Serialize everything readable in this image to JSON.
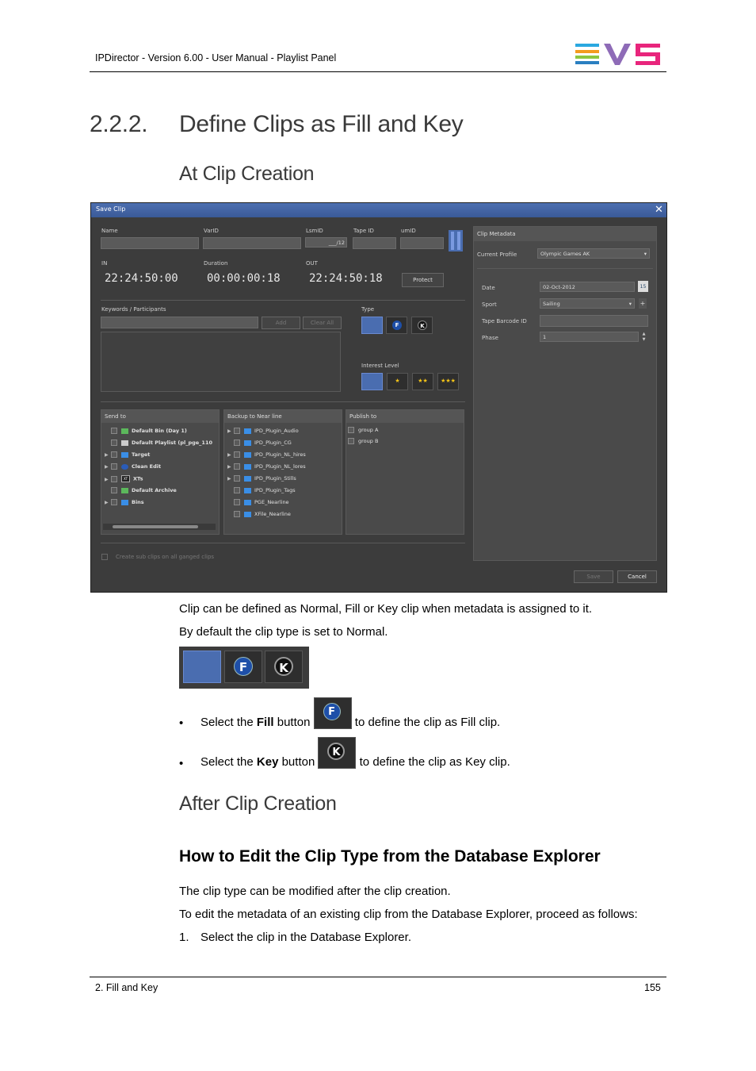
{
  "header": {
    "title": "IPDirector - Version 6.00 - User Manual - Playlist Panel",
    "logo_text": "EVS"
  },
  "section": {
    "number": "2.2.2.",
    "title": "Define Clips as Fill and Key"
  },
  "sub1": "At Clip Creation",
  "dialog": {
    "title": "Save Clip",
    "close": "✕",
    "labels": {
      "name": "Name",
      "varid": "VarID",
      "lsmid": "LsmID",
      "tapeid": "Tape ID",
      "umid": "umID",
      "in": "IN",
      "duration": "Duration",
      "out": "OUT",
      "keywords": "Keywords / Participants",
      "type": "Type",
      "interest": "Interest Level",
      "send_to": "Send to",
      "backup": "Backup to Near line",
      "publish": "Publish to",
      "metadata": "Clip Metadata",
      "profile": "Current Profile",
      "date": "Date",
      "sport": "Sport",
      "tape_barcode": "Tape Barcode ID",
      "phase": "Phase",
      "create_sub": "Create sub clips on all ganged clips"
    },
    "lsmid_value": "___/12",
    "in_value": "22:24:50:00",
    "duration_value": "00:00:00:18",
    "out_value": "22:24:50:18",
    "buttons": {
      "protect": "Protect",
      "add": "Add",
      "clear_all": "Clear All",
      "save": "Save",
      "cancel": "Cancel"
    },
    "type_buttons": [
      "",
      "F",
      "K"
    ],
    "interest_buttons": [
      "",
      "★",
      "★★",
      "★★★"
    ],
    "profile_value": "Olympic Games AK",
    "date_value": "02-Oct-2012",
    "date_icon": "15",
    "sport_value": "Sailing",
    "phase_value": "1",
    "send_to_items": [
      "Default Bin (Day 1)",
      "Default Playlist (pl_pge_110",
      "Target",
      "Clean Edit",
      "XTs",
      "Default Archive",
      "Bins"
    ],
    "xt_icon_text": "XT",
    "backup_items": [
      "IPD_Plugin_Audio",
      "IPD_Plugin_CG",
      "IPD_Plugin_NL_hires",
      "IPD_Plugin_NL_lores",
      "IPD_Plugin_Stills",
      "IPD_Plugin_Tags",
      "PGE_Nearline",
      "XFile_Nearline"
    ],
    "publish_items": [
      "group A",
      "group B"
    ]
  },
  "para1": "Clip can be defined as Normal, Fill or Key clip when metadata is assigned to it.",
  "para2": "By default the clip type is set to Normal.",
  "fill_icon": "F",
  "key_icon": "K",
  "bullet_fill": {
    "pre": "Select the ",
    "bold": "Fill",
    "mid": " button",
    "post": "to define the clip as Fill clip."
  },
  "bullet_key": {
    "pre": "Select the ",
    "bold": "Key",
    "mid": " button",
    "post": "to define the clip as Key clip."
  },
  "sub2": "After Clip Creation",
  "h3": "How to Edit the Clip Type from the Database Explorer",
  "para3": "The clip type can be modified after the clip creation.",
  "para4": "To edit the metadata of an existing clip from the Database Explorer, proceed as follows:",
  "step1_num": "1.",
  "step1": "Select the clip in the Database Explorer.",
  "footer": {
    "left": "2. Fill and Key",
    "page": "155"
  },
  "colors": {
    "accent_blue": "#4a6db0",
    "heading_gray": "#3a3a3a"
  }
}
